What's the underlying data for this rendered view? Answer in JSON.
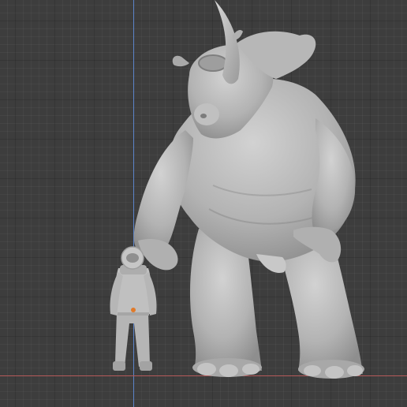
{
  "viewport": {
    "background": "#3d3d3d",
    "grid_color": "#2a2a2a",
    "x_axis_color": "#b55a5a",
    "y_axis_color": "#5c84c9"
  },
  "models": {
    "creature": {
      "name": "rhino-monster-sculpt",
      "shade": "#b9b9b9"
    },
    "figure": {
      "name": "astronaut-figure-sculpt",
      "shade": "#bcbcbc",
      "accent": "#e07a2a"
    }
  }
}
